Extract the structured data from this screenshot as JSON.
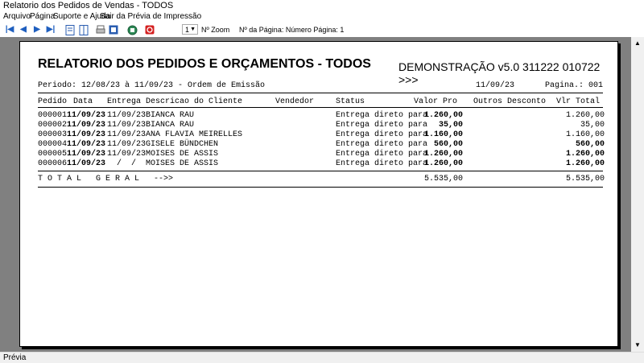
{
  "window": {
    "title": "Relatorio dos Pedidos de Vendas - TODOS"
  },
  "menu": [
    "Arquivo",
    "Página",
    "Suporte e Ajuda",
    "Sair da Prévia de Impressão"
  ],
  "toolbar": {
    "zoom_value": "1",
    "zoom_label": "Nº Zoom",
    "page_label": "Nº da Página: Número Página: 1"
  },
  "report": {
    "title": "RELATORIO DOS PEDIDOS E ORÇAMENTOS - TODOS",
    "demo": "DEMONSTRAÇÃO v5.0 311222 010722 >>>",
    "period": "Periodo: 12/08/23 à 11/09/23 - Ordem de Emissão",
    "date": "11/09/23",
    "page": "Pagina.: 001",
    "headers": {
      "pedido": "Pedido",
      "data": "Data",
      "entrega": "Entrega",
      "descricao": "Descricao do Cliente",
      "vendedor": "Vendedor",
      "status": "Status",
      "valor": "Valor Pro",
      "outros": "Outros Desconto",
      "total": "Vlr Total"
    },
    "rows": [
      {
        "pedido": "000001",
        "data": "11/09/23",
        "entrega": "11/09/23",
        "cliente": "BIANCA RAU",
        "status": "Entrega direto para",
        "valor": "1.260,00",
        "total": "1.260,00",
        "bold_total": false
      },
      {
        "pedido": "000002",
        "data": "11/09/23",
        "entrega": "11/09/23",
        "cliente": "BIANCA RAU",
        "status": "Entrega direto para",
        "valor": "35,00",
        "total": "35,00",
        "bold_total": false
      },
      {
        "pedido": "000003",
        "data": "11/09/23",
        "entrega": "11/09/23",
        "cliente": "ANA FLAVIA MEIRELLES",
        "status": "Entrega direto para",
        "valor": "1.160,00",
        "total": "1.160,00",
        "bold_total": false
      },
      {
        "pedido": "000004",
        "data": "11/09/23",
        "entrega": "11/09/23",
        "cliente": "GISELE BÜNDCHEN",
        "status": "Entrega direto para",
        "valor": "560,00",
        "total": "560,00",
        "bold_total": true
      },
      {
        "pedido": "000005",
        "data": "11/09/23",
        "entrega": "11/09/23",
        "cliente": "MOISES DE ASSIS",
        "status": "Entrega direto para",
        "valor": "1.260,00",
        "total": "1.260,00",
        "bold_total": true
      },
      {
        "pedido": "000006",
        "data": "11/09/23",
        "entrega": "  /  /",
        "cliente": "MOISES DE ASSIS",
        "status": "Entrega direto para",
        "valor": "1.260,00",
        "total": "1.260,00",
        "bold_total": true
      }
    ],
    "total_label": "T O T A L   G E R A L   -->>",
    "total_valor": "5.535,00",
    "total_total": "5.535,00"
  },
  "status_bar": "Prévia"
}
